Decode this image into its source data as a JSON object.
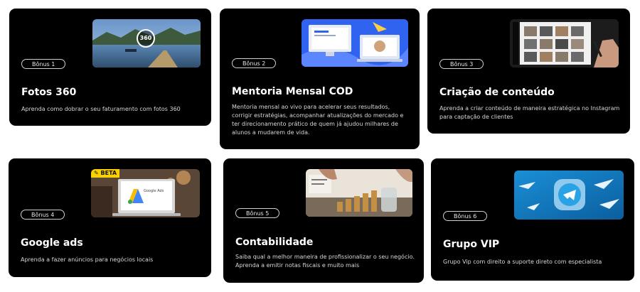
{
  "cards": [
    {
      "badge": "Bônus 1",
      "title": "Fotos 360",
      "desc": "Aprenda como dobrar o seu faturamento com fotos 360",
      "thumb_label": "360"
    },
    {
      "badge": "Bônus 2",
      "title": "Mentoria Mensal COD",
      "desc": "Mentoria mensal ao vivo para acelerar seus resultados, corrigir estratégias, acompanhar atualizações do mercado e ter direcionamento prático de quem já ajudou milhares de alunos a mudarem de vida."
    },
    {
      "badge": "Bônus 3",
      "title": "Criação de conteúdo",
      "desc": "Aprenda a criar conteúdo de maneira estratégica no Instagram para captação de clientes"
    },
    {
      "badge": "Bônus 4",
      "title": "Google ads",
      "desc": "Aprenda a fazer anúncios para negócios locais",
      "thumb_tag": "BETA",
      "thumb_label": "Google Ads"
    },
    {
      "badge": "Bônus 5",
      "title": "Contabilidade",
      "desc": "Saiba qual a melhor maneira de profissionalizar o seu negócio. Aprenda a emitir notas fiscais e muito mais"
    },
    {
      "badge": "Bônus 6",
      "title": "Grupo VIP",
      "desc": "Grupo Vip com direito a suporte direto com especialista"
    }
  ]
}
